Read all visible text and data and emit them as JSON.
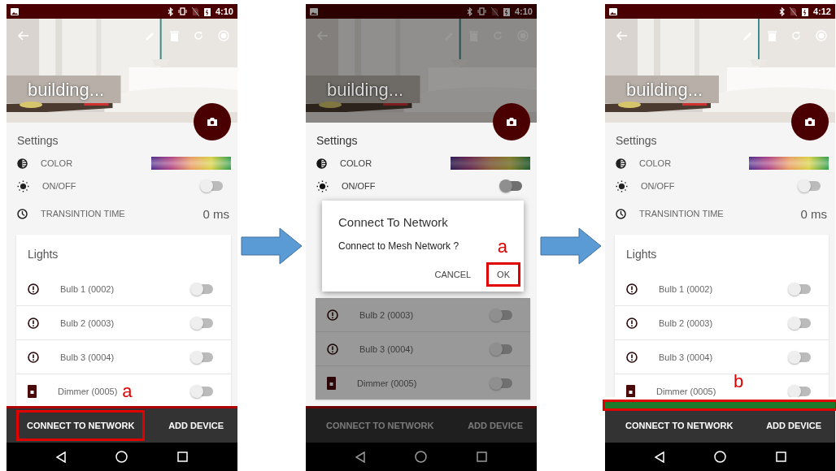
{
  "screens": [
    {
      "status": {
        "time": "4:10",
        "vibrate": true
      },
      "title": "building...",
      "dimmed": false,
      "settings": {
        "title": "Settings",
        "rows": [
          {
            "kind": "color",
            "label": "COLOR"
          },
          {
            "kind": "switch",
            "label": "ON/OFF",
            "on": false
          },
          {
            "kind": "value",
            "label": "TRANSINTION TIME",
            "value": "0 ms"
          }
        ]
      },
      "lights": {
        "title": "Lights",
        "items": [
          {
            "kind": "bulb",
            "name": "Bulb 1 (0002)",
            "on": false
          },
          {
            "kind": "bulb",
            "name": "Bulb 2 (0003)",
            "on": false
          },
          {
            "kind": "bulb",
            "name": "Bulb 3 (0004)",
            "on": false
          },
          {
            "kind": "dimmer",
            "name": "Dimmer (0005)",
            "on": false,
            "annotation": "a"
          }
        ]
      },
      "bottom_bar": {
        "buttons": [
          {
            "label": "CONNECT TO NETWORK",
            "highlighted": true
          },
          {
            "label": "ADD DEVICE",
            "highlighted": false
          }
        ]
      }
    },
    {
      "status": {
        "time": "4:10",
        "vibrate": true
      },
      "title": "building...",
      "dimmed": true,
      "settings": {
        "title": "Settings",
        "rows": [
          {
            "kind": "color",
            "label": "COLOR"
          },
          {
            "kind": "switch",
            "label": "ON/OFF",
            "on": false
          }
        ]
      },
      "dialog": {
        "title": "Connect To Network",
        "message": "Connect to Mesh Network ?",
        "annotation": "a",
        "buttons": [
          {
            "label": "CANCEL",
            "highlighted": false
          },
          {
            "label": "OK",
            "highlighted": true
          }
        ]
      },
      "lights": {
        "items": [
          {
            "kind": "bulb",
            "name": "Bulb 2 (0003)",
            "on": false
          },
          {
            "kind": "bulb",
            "name": "Bulb 3 (0004)",
            "on": false
          },
          {
            "kind": "dimmer",
            "name": "Dimmer (0005)",
            "on": false
          }
        ]
      },
      "bottom_bar": {
        "buttons": [
          {
            "label": "CONNECT TO NETWORK",
            "highlighted": false
          },
          {
            "label": "ADD DEVICE",
            "highlighted": false
          }
        ]
      }
    },
    {
      "status": {
        "time": "4:12",
        "vibrate": false
      },
      "title": "building...",
      "dimmed": false,
      "settings": {
        "title": "Settings",
        "rows": [
          {
            "kind": "color",
            "label": "COLOR"
          },
          {
            "kind": "switch",
            "label": "ON/OFF",
            "on": false
          },
          {
            "kind": "value",
            "label": "TRANSINTION TIME",
            "value": "0 ms"
          }
        ]
      },
      "lights": {
        "title": "Lights",
        "items": [
          {
            "kind": "bulb",
            "name": "Bulb 1 (0002)",
            "on": false
          },
          {
            "kind": "bulb",
            "name": "Bulb 2 (0003)",
            "on": false
          },
          {
            "kind": "bulb",
            "name": "Bulb 3 (0004)",
            "on": false
          },
          {
            "kind": "dimmer",
            "name": "Dimmer (0005)",
            "on": false
          }
        ]
      },
      "bottom_bar": {
        "progress": {
          "level": 1,
          "highlighted": true,
          "annotation": "b"
        },
        "buttons": [
          {
            "label": "CONNECT TO NETWORK",
            "highlighted": false
          },
          {
            "label": "ADD DEVICE",
            "highlighted": false
          }
        ]
      }
    }
  ]
}
